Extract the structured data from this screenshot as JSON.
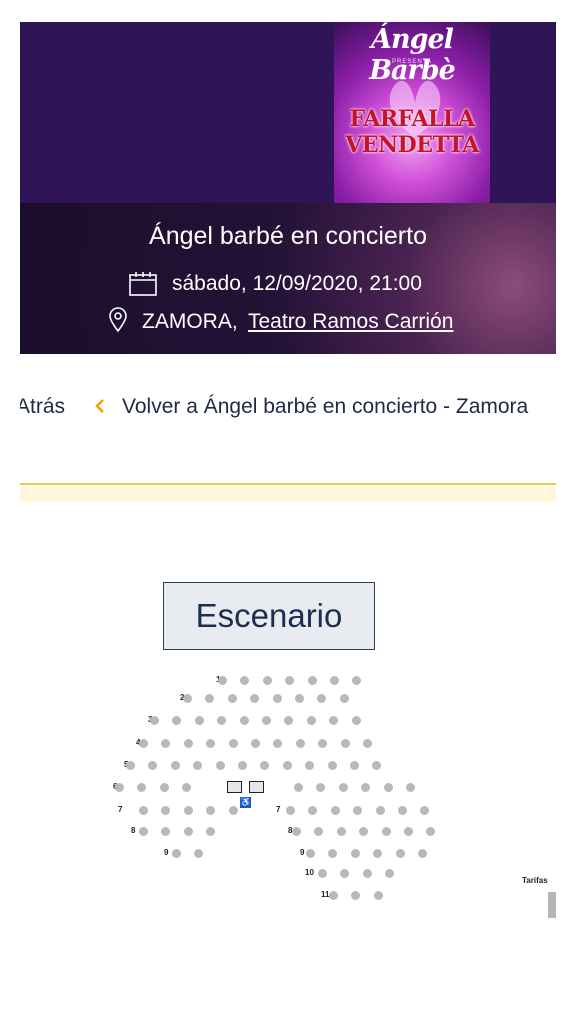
{
  "event": {
    "title": "Ángel barbé en concierto",
    "date": "sábado, 12/09/2020, 21:00",
    "city": "ZAMORA,",
    "venue": "Teatro Ramos Carrión",
    "poster": {
      "artist": "Ángel Barbè",
      "presenta": "PRESENTA",
      "title_line1": "FARFALLA",
      "title_line2": "VENDETTA"
    }
  },
  "nav": {
    "back_label": "Atrás",
    "return_label": "Volver a Ángel barbé en concierto - Zamora"
  },
  "seating": {
    "stage_label": "Escenario",
    "tarifas_label": "Tarifas",
    "rows": [
      {
        "label": "1",
        "seats": 7
      },
      {
        "label": "2",
        "seats": 8
      },
      {
        "label": "3",
        "seats": 10
      },
      {
        "label": "4",
        "seats": 11
      },
      {
        "label": "5",
        "seats": 12
      },
      {
        "label": "6",
        "seats": 12,
        "wheelchair_seats": 2
      },
      {
        "label": "7",
        "seats": 12
      },
      {
        "label": "8",
        "seats": 11
      },
      {
        "label": "9",
        "seats": 8
      },
      {
        "label": "10",
        "seats": 4
      },
      {
        "label": "11",
        "seats": 3
      }
    ]
  },
  "colors": {
    "header_purple": "#2f1458",
    "seat_available": "#b8b8b8",
    "accent_yellow": "#f2c94c",
    "wheelchair_blue": "#1a5fb4"
  }
}
